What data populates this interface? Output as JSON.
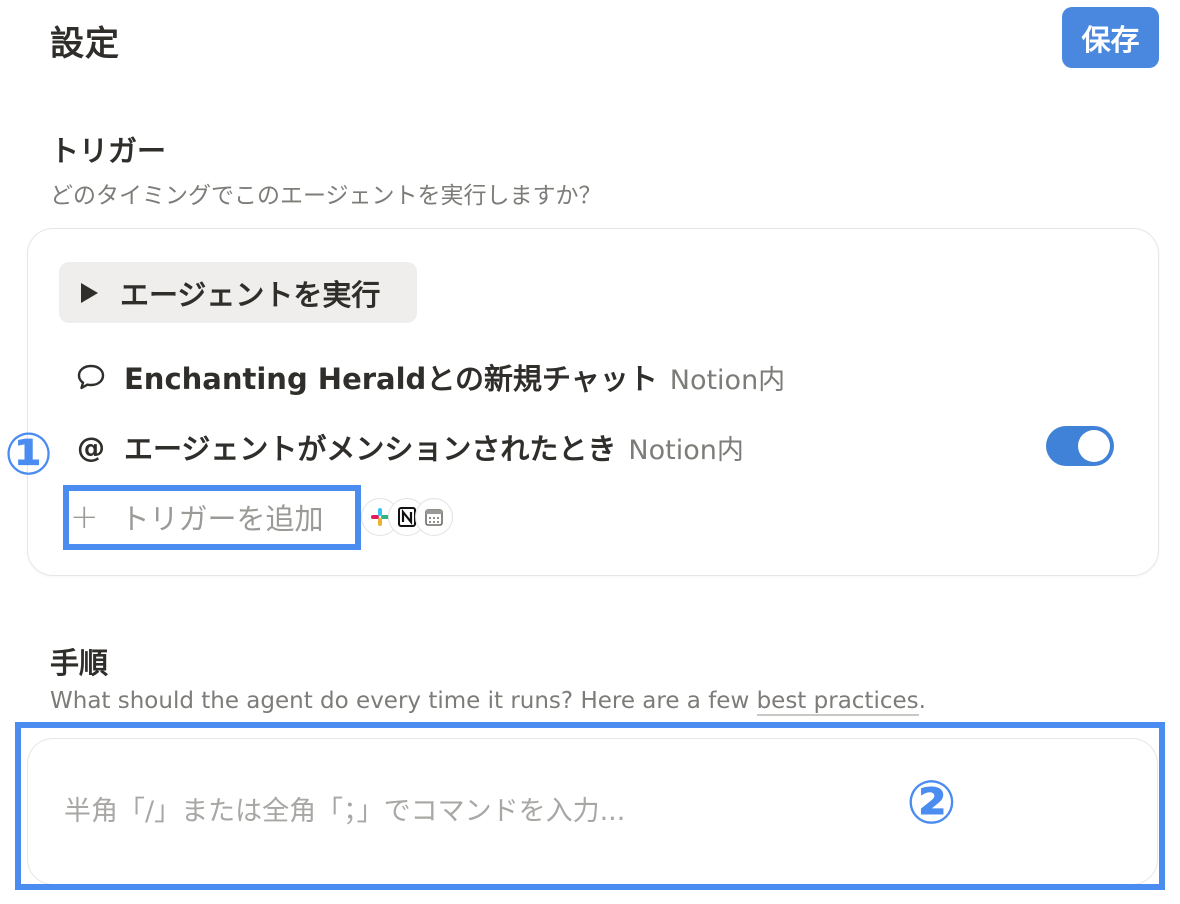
{
  "header": {
    "title": "設定",
    "save_label": "保存"
  },
  "triggers": {
    "heading": "トリガー",
    "description": "どのタイミングでこのエージェントを実行しますか？",
    "run_button_label": "エージェントを実行",
    "items": [
      {
        "icon": "chat-bubble-icon",
        "label": "Enchanting Heraldとの新規チャット",
        "sub": "Notion内"
      },
      {
        "icon": "at-icon",
        "label": "エージェントがメンションされたとき",
        "sub": "Notion内",
        "toggle_on": true
      }
    ],
    "add_label": "トリガーを追加",
    "integrations": [
      "slack-icon",
      "notion-icon",
      "calendar-icon"
    ]
  },
  "instructions": {
    "heading": "手順",
    "description_prefix": "What should the agent do every time it runs? Here are a few ",
    "description_link": "best practices",
    "description_suffix": ".",
    "placeholder": "半角「/」または全角「；」でコマンドを入力..."
  },
  "annotations": {
    "marker_1": "①",
    "marker_2": "②"
  },
  "colors": {
    "accent": "#4a88e0",
    "annotation": "#4b8cf0",
    "toggle_on": "#3f82d8"
  }
}
